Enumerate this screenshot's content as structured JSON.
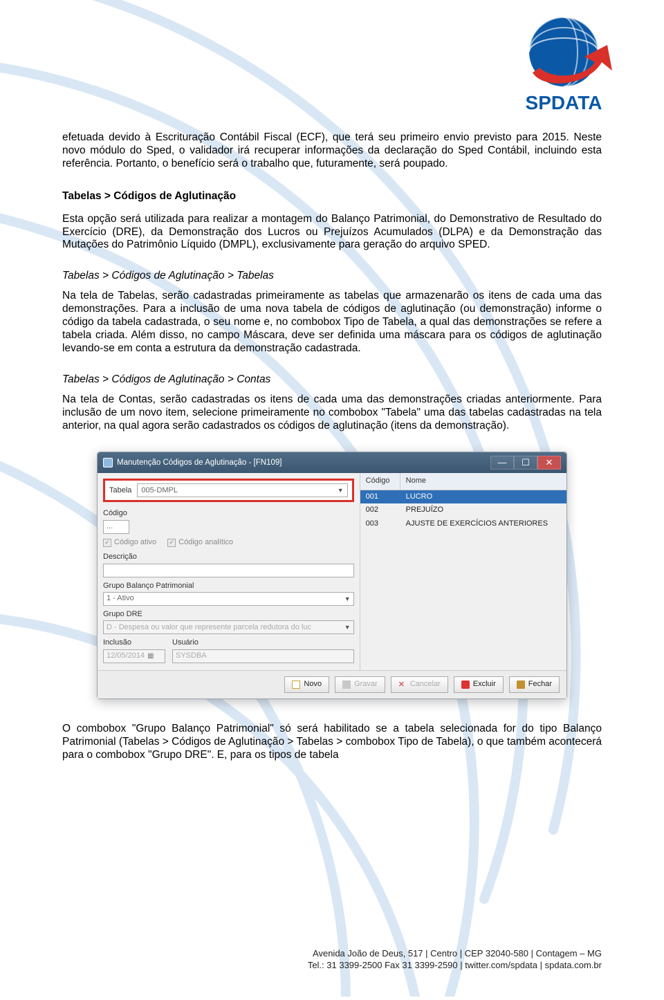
{
  "logo_text": "SPDATA",
  "body": {
    "p1": "efetuada devido à Escrituração Contábil Fiscal (ECF), que terá seu primeiro envio previsto para 2015. Neste novo módulo do Sped, o validador irá recuperar informações da declaração do Sped Contábil, incluindo esta referência. Portanto, o benefício será o trabalho que, futuramente, será poupado.",
    "h1": "Tabelas > Códigos de Aglutinação",
    "p2": "Esta opção será utilizada para realizar a montagem do Balanço Patrimonial, do Demonstrativo de Resultado do Exercício (DRE), da Demonstração dos Lucros ou Prejuízos Acumulados (DLPA) e da Demonstração das Mutações do Patrimônio Líquido (DMPL), exclusivamente para geração do arquivo SPED.",
    "h2": "Tabelas > Códigos de Aglutinação > Tabelas",
    "p3": "Na tela de Tabelas, serão cadastradas primeiramente as tabelas que armazenarão os itens de cada uma das demonstrações. Para a inclusão de uma nova tabela de códigos de aglutinação (ou demonstração) informe o código da tabela cadastrada, o seu nome e, no combobox Tipo de Tabela, a qual das demonstrações se refere a tabela criada. Além disso, no campo Máscara, deve ser definida uma máscara para os códigos de aglutinação levando-se em conta a estrutura da demonstração cadastrada.",
    "h3": "Tabelas > Códigos de Aglutinação > Contas",
    "p4": "Na tela de Contas, serão cadastradas os itens de cada uma das demonstrações criadas anteriormente. Para inclusão de um novo item, selecione primeiramente no combobox \"Tabela\" uma das tabelas cadastradas na tela anterior, na qual agora serão cadastrados os códigos de aglutinação (itens da demonstração).",
    "p5": "O combobox \"Grupo Balanço Patrimonial\" só será habilitado se a tabela selecionada for do tipo Balanço Patrimonial (Tabelas > Códigos de Aglutinação > Tabelas > combobox Tipo de Tabela), o que também acontecerá para o combobox \"Grupo DRE\". E, para os tipos de tabela"
  },
  "window": {
    "title": "Manutenção Códigos de Aglutinação - [FN109]",
    "tabela_label": "Tabela",
    "tabela_value": "005-DMPL",
    "codigo_label": "Código",
    "codigo_value": "...",
    "cb_ativo": "Código ativo",
    "cb_analitico": "Código analítico",
    "descricao_label": "Descrição",
    "grupo_bp_label": "Grupo Balanço Patrimonial",
    "grupo_bp_value": "1 - Ativo",
    "grupo_dre_label": "Grupo DRE",
    "grupo_dre_value": "D - Despesa ou valor que represente parcela redutora do luc",
    "inclusao_label": "Inclusão",
    "inclusao_date": "12/05/2014",
    "usuario_label": "Usuário",
    "usuario_value": "SYSDBA",
    "grid": {
      "col1": "Código",
      "col2": "Nome",
      "rows": [
        {
          "c": "001",
          "n": "LUCRO",
          "selected": true
        },
        {
          "c": "002",
          "n": "PREJUÍZO",
          "selected": false
        },
        {
          "c": "003",
          "n": "AJUSTE DE EXERCÍCIOS ANTERIORES",
          "selected": false
        }
      ]
    },
    "buttons": {
      "novo": "Novo",
      "gravar": "Gravar",
      "cancelar": "Cancelar",
      "excluir": "Excluir",
      "fechar": "Fechar"
    }
  },
  "footer": {
    "line1": "Avenida João de Deus, 517 | Centro | CEP 32040-580 | Contagem – MG",
    "line2": "Tel.: 31 3399-2500 Fax 31 3399-2590 | twitter.com/spdata | spdata.com.br"
  }
}
